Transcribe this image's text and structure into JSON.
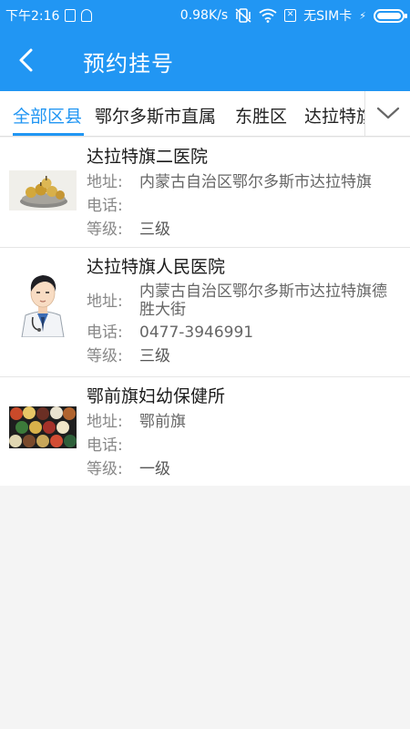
{
  "status_bar": {
    "time": "下午2:16",
    "network_speed": "0.98K/s",
    "sim_status": "无SIM卡",
    "sim_glyph": "✕",
    "charging_glyph": "⚡",
    "battery_percent": 100
  },
  "header": {
    "back_icon": "chevron-left-icon",
    "title": "预约挂号"
  },
  "tabs": [
    {
      "label": "全部区县",
      "active": true
    },
    {
      "label": "鄂尔多斯市直属",
      "active": false
    },
    {
      "label": "东胜区",
      "active": false
    },
    {
      "label": "达拉特旗",
      "active": false
    }
  ],
  "expand_icon": "chevron-down-icon",
  "labels": {
    "address": "地址:",
    "phone": "电话:",
    "level": "等级:"
  },
  "hospitals": [
    {
      "name": "达拉特旗二医院",
      "address": "内蒙古自治区鄂尔多斯市达拉特旗",
      "phone": "",
      "level": "三级",
      "image": "fruit-bowl-photo"
    },
    {
      "name": "达拉特旗人民医院",
      "address": "内蒙古自治区鄂尔多斯市达拉特旗德胜大街",
      "phone": "0477-3946991",
      "level": "三级",
      "image": "doctor-illustration"
    },
    {
      "name": "鄂前旗妇幼保健所",
      "address": "鄂前旗",
      "phone": "",
      "level": "一级",
      "image": "bowls-of-grains-photo"
    }
  ],
  "colors": {
    "primary": "#2196f3",
    "background": "#f4f4f4"
  }
}
